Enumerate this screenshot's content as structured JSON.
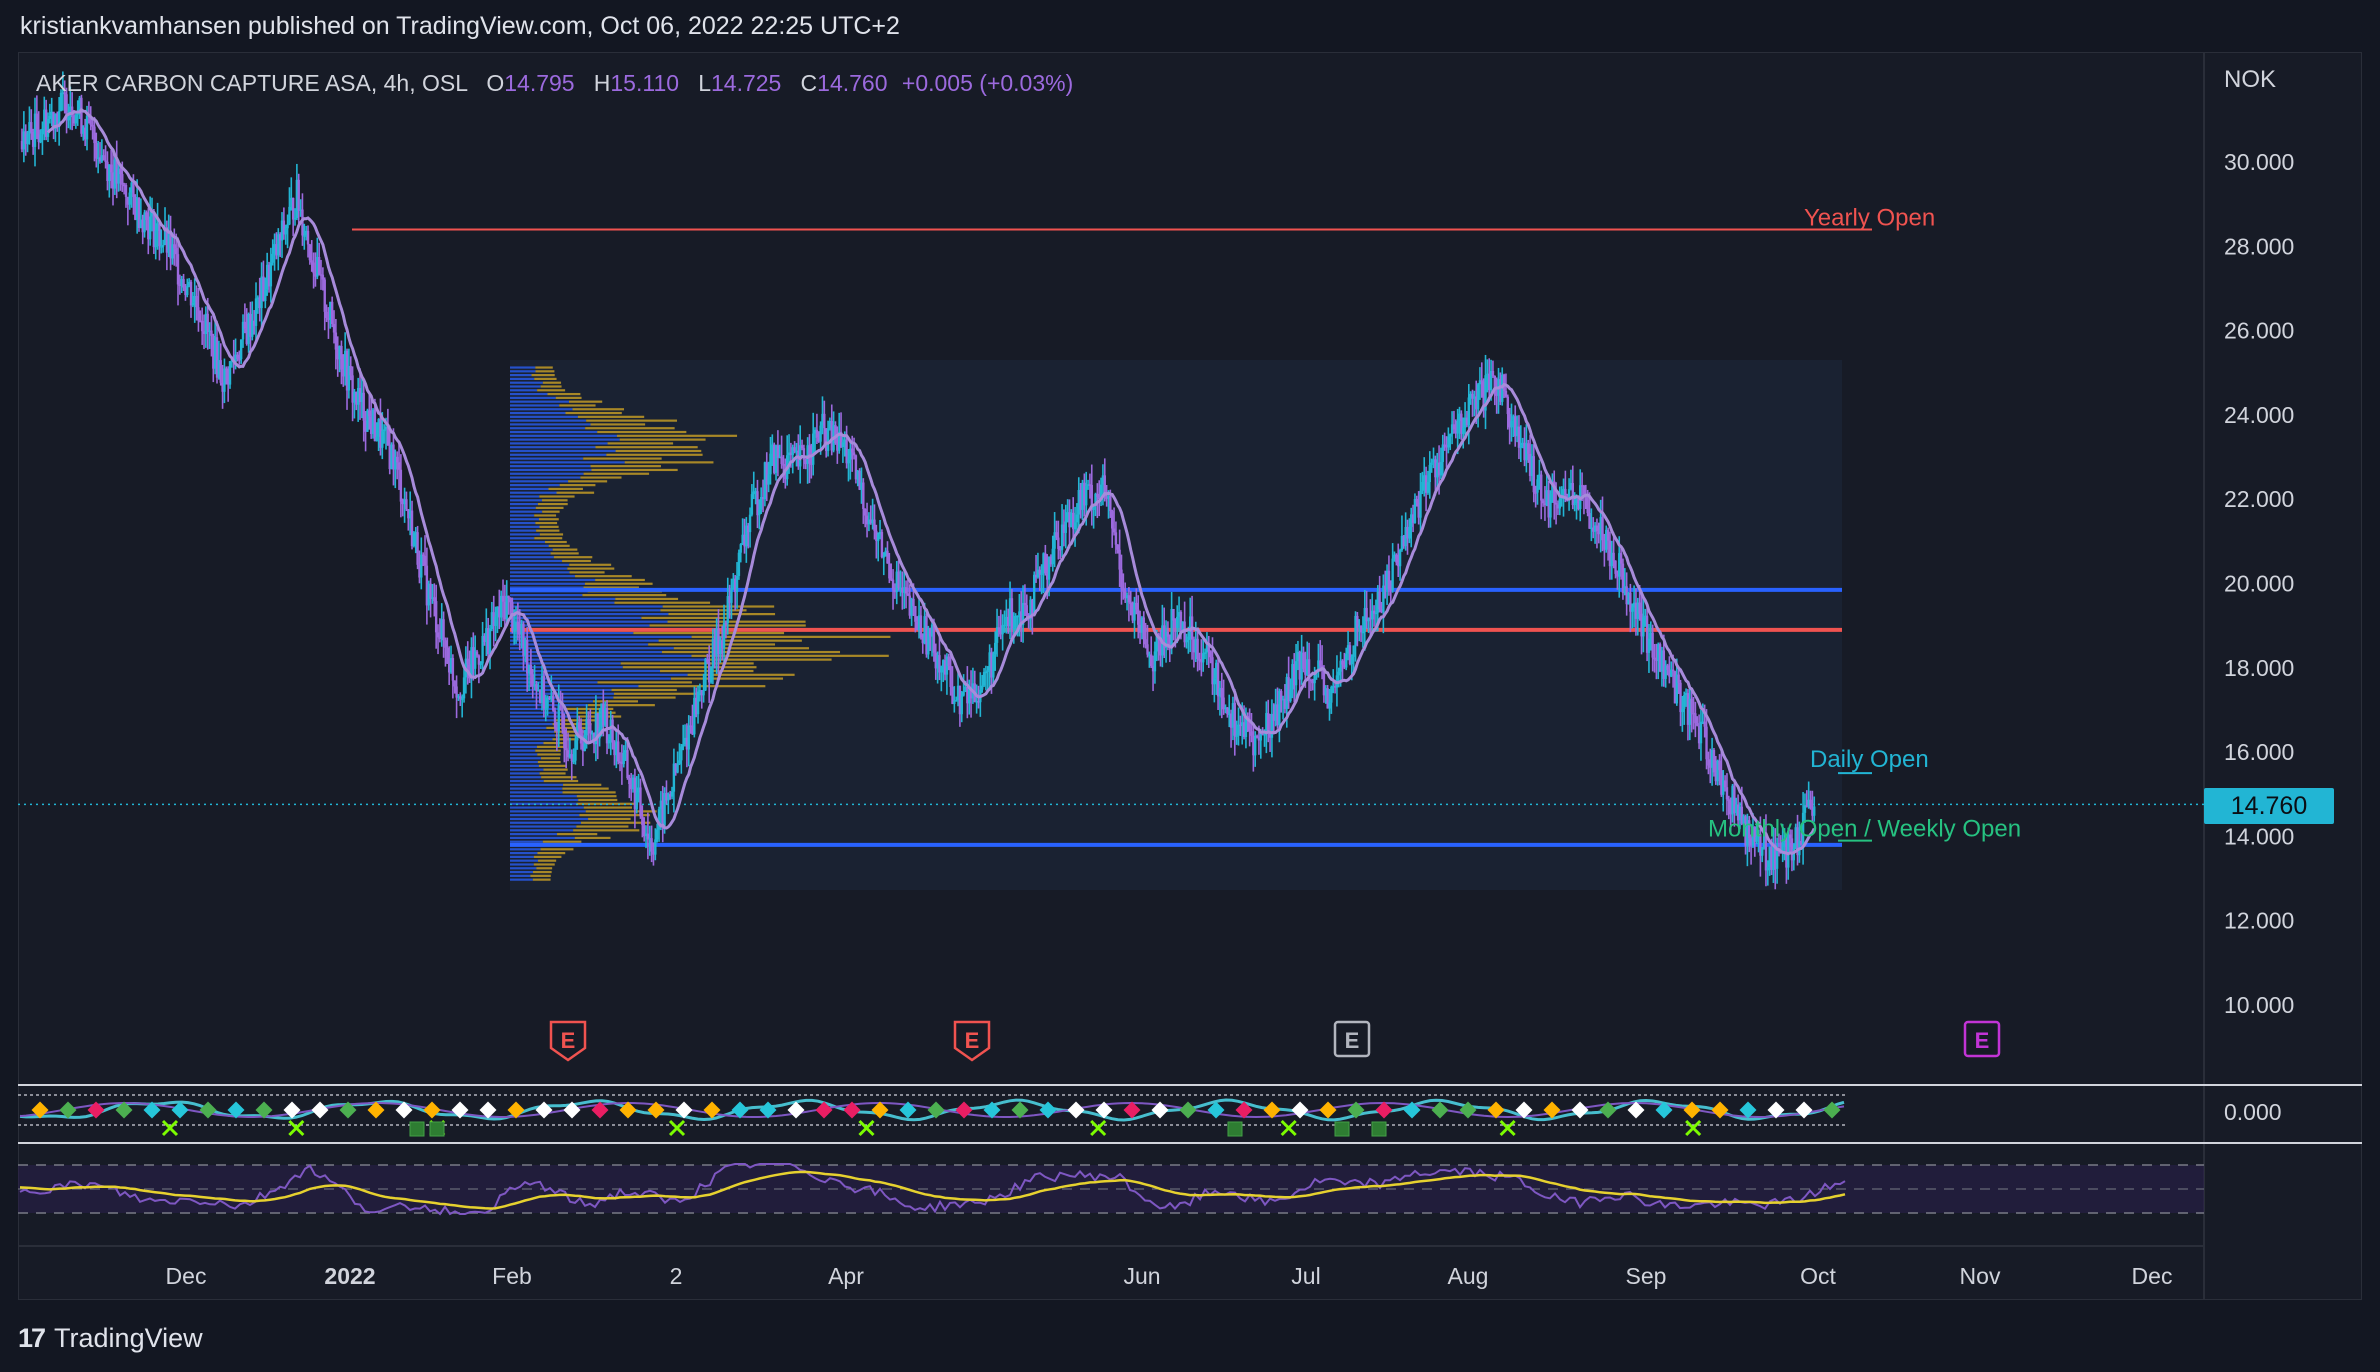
{
  "header": {
    "published_line": "kristiankvamhansen published on TradingView.com, Oct 06, 2022 22:25 UTC+2"
  },
  "legend": {
    "symbol": "AKER CARBON CAPTURE ASA, 4h, OSL",
    "open_label": "O",
    "open": "14.795",
    "high_label": "H",
    "high": "15.110",
    "low_label": "L",
    "low": "14.725",
    "close_label": "C",
    "close": "14.760",
    "change": "+0.005 (+0.03%)"
  },
  "currency": "NOK",
  "last_price": "14.760",
  "price_axis": {
    "ticks": [
      "30.000",
      "28.000",
      "26.000",
      "24.000",
      "22.000",
      "20.000",
      "18.000",
      "16.000",
      "14.000",
      "12.000",
      "10.000"
    ]
  },
  "oscillator_axis": {
    "zero_label": "0.000"
  },
  "time_axis": {
    "ticks": [
      "Dec",
      "2022",
      "Feb",
      "2",
      "Apr",
      "Jun",
      "Jul",
      "Aug",
      "Sep",
      "Oct",
      "Nov",
      "Dec"
    ]
  },
  "levels": {
    "yearly_open": {
      "label": "Yearly Open",
      "value": 28.4,
      "color": "#f05350"
    },
    "daily_open": {
      "label": "Daily Open",
      "value": 15.5,
      "color": "#22b5d4"
    },
    "monthly_weekly_open": {
      "label": "Monthly Open / Weekly Open",
      "value": 13.9,
      "color": "#26c281"
    },
    "range_high": {
      "value": 19.85,
      "color": "#2962ff"
    },
    "range_low": {
      "value": 13.8,
      "color": "#2962ff"
    },
    "poc": {
      "value": 18.9,
      "color": "#f05350"
    }
  },
  "earnings_markers": [
    {
      "label": "E",
      "color": "#f05350",
      "style": "past"
    },
    {
      "label": "E",
      "color": "#f05350",
      "style": "past"
    },
    {
      "label": "E",
      "color": "#b2b5be",
      "style": "neutral"
    },
    {
      "label": "E",
      "color": "#c234d6",
      "style": "future"
    }
  ],
  "colors": {
    "background": "#131722",
    "candle_up": "#22b5d4",
    "candle_down": "#9c6ade",
    "ma": "#a78bda",
    "rsi": "#7e57c2",
    "rsi_ma": "#e6d12f",
    "volume_profile_blue": "#2962ff",
    "volume_profile_yellow": "#e6b422"
  },
  "footer": {
    "brand": "TradingView",
    "logo_glyph": "17"
  },
  "chart_data": {
    "type": "candlestick",
    "title": "AKER CARBON CAPTURE ASA, 4h, OSL",
    "ylim": [
      8,
      32
    ],
    "x_ticks": [
      "Dec",
      "2022",
      "Feb",
      "2",
      "Apr",
      "Jun",
      "Jul",
      "Aug",
      "Sep",
      "Oct",
      "Nov",
      "Dec"
    ],
    "y_ticks": [
      10,
      12,
      14,
      16,
      18,
      20,
      22,
      24,
      26,
      28,
      30
    ],
    "series": [
      {
        "name": "price",
        "points": [
          [
            0,
            30.5
          ],
          [
            0.3,
            31.5
          ],
          [
            0.6,
            29.5
          ],
          [
            0.9,
            28
          ],
          [
            1.1,
            26.5
          ],
          [
            1.25,
            24.8
          ],
          [
            1.45,
            26.5
          ],
          [
            1.7,
            29.2
          ],
          [
            1.85,
            27
          ],
          [
            2.05,
            24.5
          ],
          [
            2.3,
            23
          ],
          [
            2.5,
            20
          ],
          [
            2.7,
            17.5
          ],
          [
            2.85,
            18.5
          ],
          [
            3.0,
            19.6
          ],
          [
            3.2,
            17.5
          ],
          [
            3.4,
            16.2
          ],
          [
            3.6,
            16.8
          ],
          [
            3.75,
            15.5
          ],
          [
            3.9,
            13.8
          ],
          [
            4.05,
            15.5
          ],
          [
            4.2,
            17.5
          ],
          [
            4.35,
            19
          ],
          [
            4.5,
            21.5
          ],
          [
            4.65,
            23
          ],
          [
            4.8,
            22.8
          ],
          [
            4.95,
            23.6
          ],
          [
            5.1,
            23.2
          ],
          [
            5.3,
            21
          ],
          [
            5.5,
            19.3
          ],
          [
            5.65,
            18.5
          ],
          [
            5.8,
            17.2
          ],
          [
            5.95,
            17.6
          ],
          [
            6.1,
            19.2
          ],
          [
            6.25,
            19.6
          ],
          [
            6.4,
            21
          ],
          [
            6.55,
            22
          ],
          [
            6.7,
            22.2
          ],
          [
            6.85,
            19.5
          ],
          [
            7.0,
            18.2
          ],
          [
            7.15,
            19.2
          ],
          [
            7.3,
            18.5
          ],
          [
            7.5,
            16.8
          ],
          [
            7.65,
            16.2
          ],
          [
            7.8,
            17.2
          ],
          [
            7.95,
            18.3
          ],
          [
            8.1,
            17.2
          ],
          [
            8.25,
            18.8
          ],
          [
            8.4,
            19.5
          ],
          [
            8.55,
            21
          ],
          [
            8.7,
            22.5
          ],
          [
            8.85,
            23.4
          ],
          [
            9.0,
            24.3
          ],
          [
            9.15,
            24.8
          ],
          [
            9.3,
            23
          ],
          [
            9.45,
            22
          ],
          [
            9.6,
            22.2
          ],
          [
            9.75,
            21.5
          ],
          [
            9.9,
            20.3
          ],
          [
            10.05,
            18.8
          ],
          [
            10.2,
            17.8
          ],
          [
            10.35,
            16.8
          ],
          [
            10.5,
            15.5
          ],
          [
            10.65,
            14.3
          ],
          [
            10.8,
            13.6
          ],
          [
            10.95,
            13.6
          ],
          [
            11.1,
            14.76
          ]
        ]
      }
    ]
  }
}
